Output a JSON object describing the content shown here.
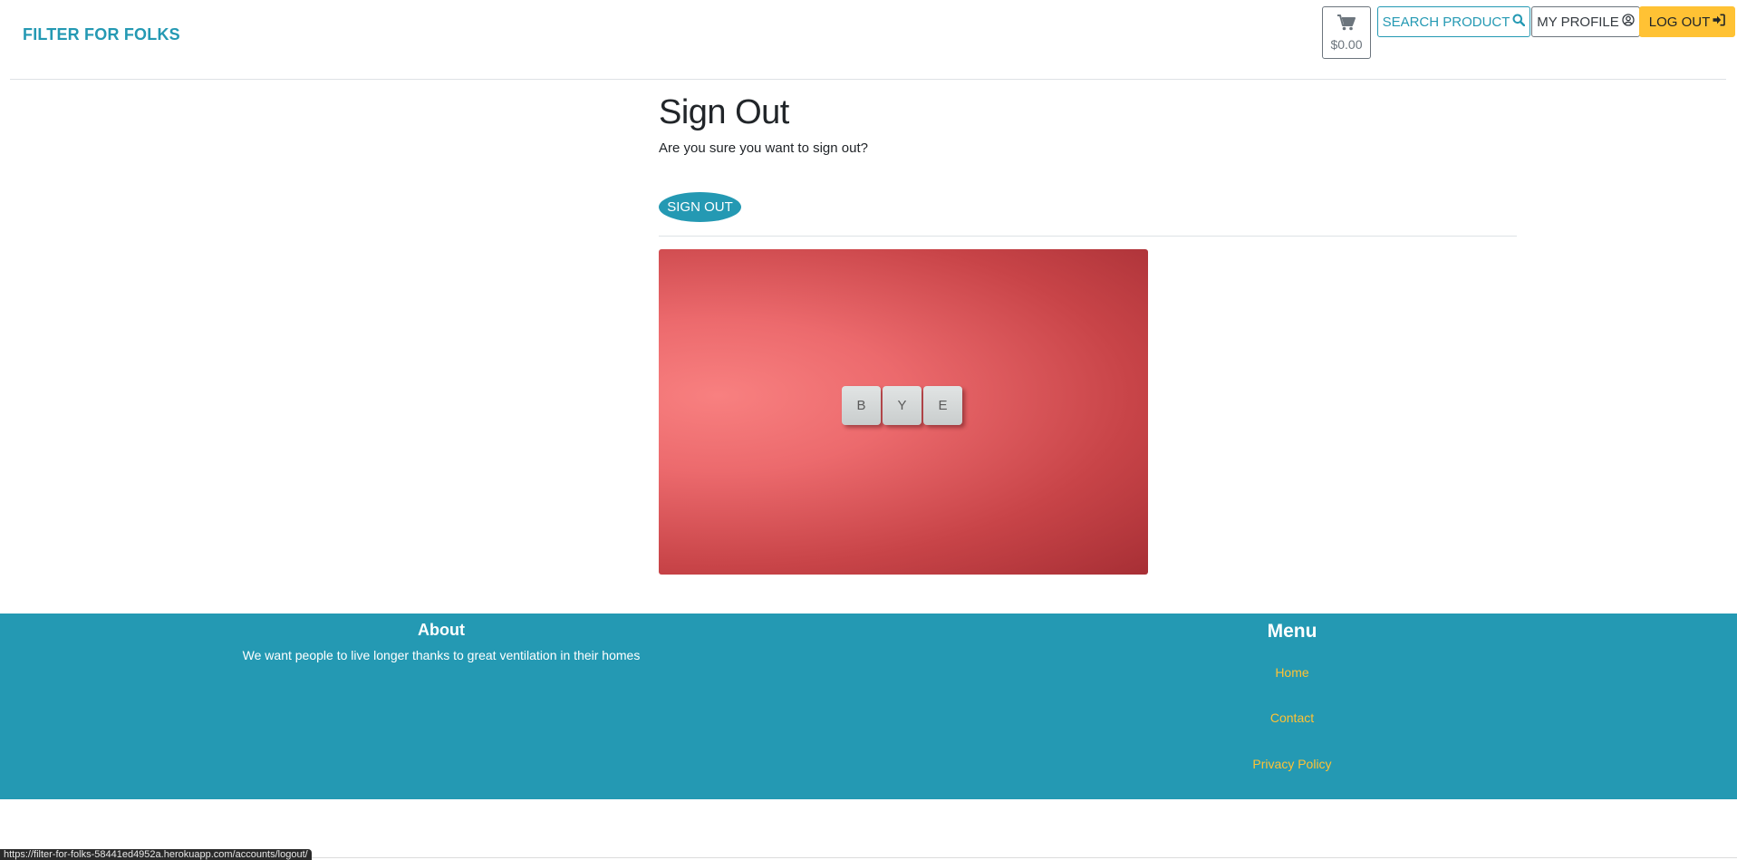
{
  "navbar": {
    "brand": "FILTER FOR FOLKS",
    "cart_total": "$0.00",
    "search_label": "SEARCH PRODUCT",
    "profile_label": "MY PROFILE",
    "logout_label": "LOG OUT",
    "icons": {
      "cart": "cart-icon",
      "search": "search-icon",
      "profile": "user-circle-icon",
      "logout": "sign-in-icon"
    }
  },
  "main": {
    "title": "Sign Out",
    "text": "Are you sure you want to sign out?",
    "signout_button": "SIGN OUT",
    "image": {
      "tiles": [
        "B",
        "Y",
        "E"
      ]
    }
  },
  "footer": {
    "about_title": "About",
    "about_text": "We want people to live longer thanks to great ventilation in their homes",
    "menu_title": "Menu",
    "links": [
      "Home",
      "Contact",
      "Privacy Policy"
    ]
  },
  "status_bar": {
    "url": "https://filter-for-folks-58441ed4952a.herokuapp.com/accounts/logout/"
  },
  "colors": {
    "primary": "#2499b3",
    "warning": "#ffc234",
    "text": "#212529"
  }
}
